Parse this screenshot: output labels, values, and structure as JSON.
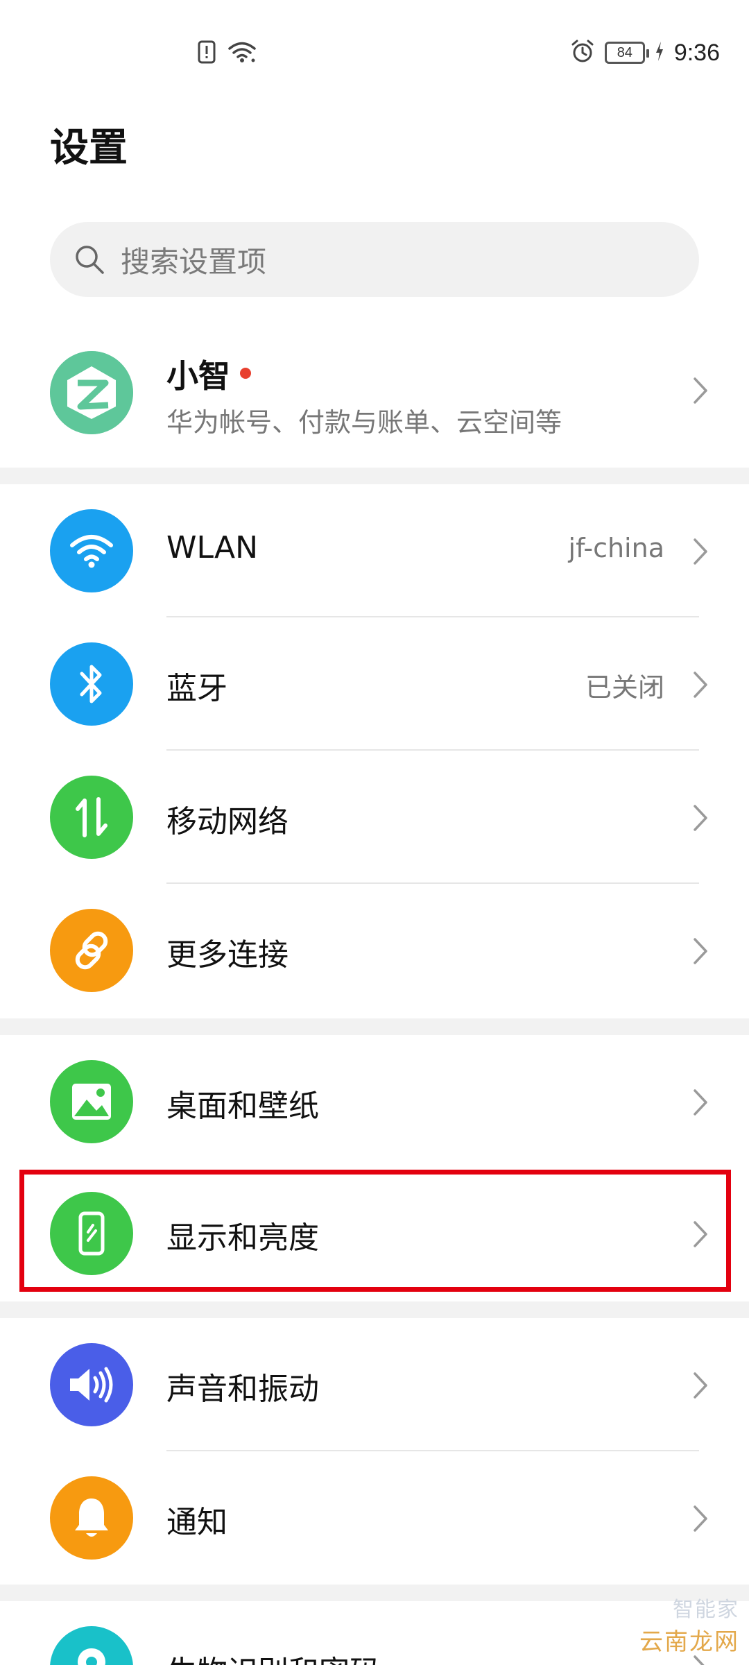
{
  "status_bar": {
    "time": "9:36",
    "battery": "84",
    "icons": [
      "sim-alert-icon",
      "wifi-icon",
      "alarm-icon",
      "battery-icon",
      "charging-icon"
    ]
  },
  "header": {
    "title": "设置"
  },
  "search": {
    "placeholder": "搜索设置项"
  },
  "account": {
    "name": "小智",
    "subtitle": "华为帐号、付款与账单、云空间等",
    "avatar_color": "#5ec79a",
    "badge_color": "#e8402f"
  },
  "sections": [
    {
      "items": [
        {
          "label": "WLAN",
          "value": "jf-china",
          "icon": "wifi-icon",
          "color": "#1aa1f0"
        },
        {
          "label": "蓝牙",
          "value": "已关闭",
          "icon": "bluetooth-icon",
          "color": "#1aa1f0"
        },
        {
          "label": "移动网络",
          "value": "",
          "icon": "mobile-data-icon",
          "color": "#3ec74a"
        },
        {
          "label": "更多连接",
          "value": "",
          "icon": "link-icon",
          "color": "#f79a10"
        }
      ]
    },
    {
      "items": [
        {
          "label": "桌面和壁纸",
          "value": "",
          "icon": "wallpaper-icon",
          "color": "#3ec74a"
        },
        {
          "label": "显示和亮度",
          "value": "",
          "icon": "display-icon",
          "color": "#3ec74a"
        }
      ]
    },
    {
      "items": [
        {
          "label": "声音和振动",
          "value": "",
          "icon": "volume-icon",
          "color": "#4a5ee8"
        },
        {
          "label": "通知",
          "value": "",
          "icon": "bell-icon",
          "color": "#f79a10"
        }
      ]
    },
    {
      "items": [
        {
          "label": "生物识别和密码",
          "value": "",
          "icon": "location-pin-icon",
          "color": "#19c1c9"
        }
      ]
    }
  ],
  "highlight_color": "#e3000f",
  "watermark": {
    "brand": "智能家",
    "site": "云南龙网"
  }
}
